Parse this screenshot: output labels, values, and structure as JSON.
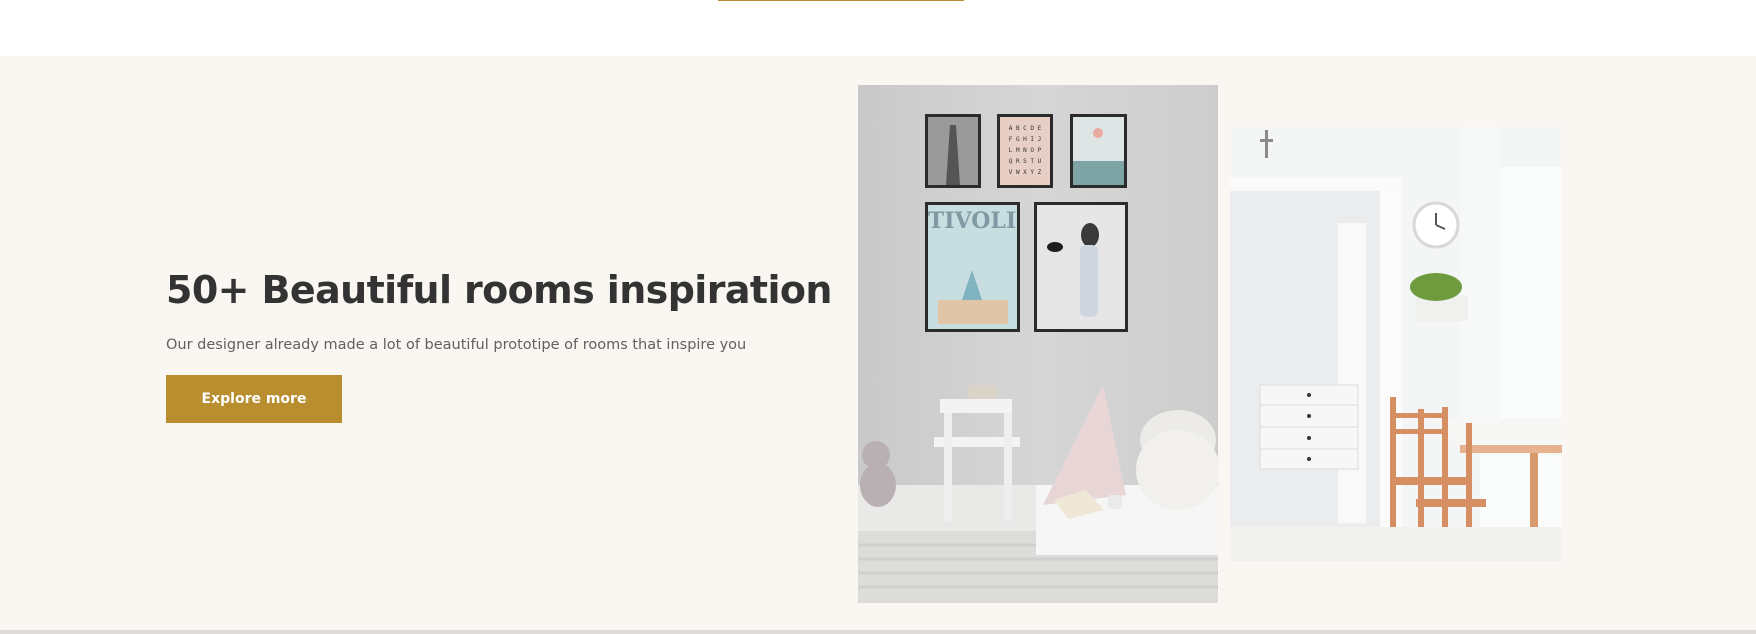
{
  "hero": {
    "headline": "50+ Beautiful rooms inspiration",
    "description": "Our designer already made a lot of beautiful prototipe of rooms that inspire you",
    "cta_label": "Explore more"
  },
  "gallery": {
    "poster_alphabet_rows": [
      "A B C D E",
      "F G H I J",
      "L M N O P",
      "Q R S T U",
      "V W X Y Z"
    ],
    "poster_tivoli_label": "TIVOLI"
  },
  "colors": {
    "accent": "#b88e2f",
    "section_background": "#faf7f2",
    "headline": "#333333",
    "body_text": "#616161"
  }
}
